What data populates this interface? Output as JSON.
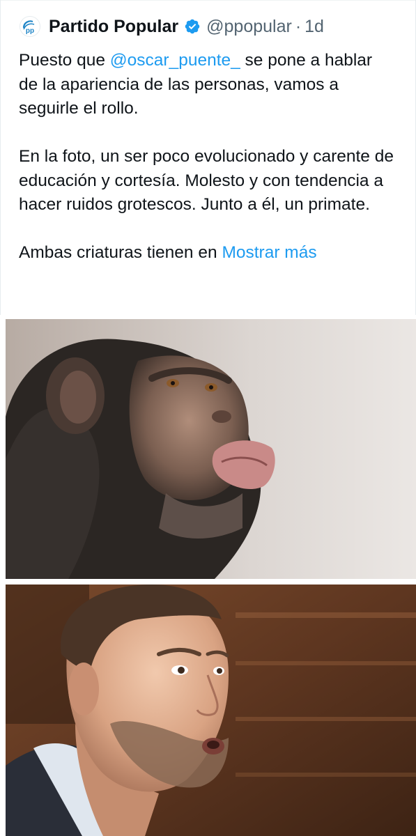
{
  "author": {
    "name": "Partido Popular",
    "handle": "@ppopular",
    "separator": "·",
    "time": "1d",
    "verified": true,
    "avatar_text": "pp",
    "avatar_color": "#1d84c6"
  },
  "tweet": {
    "line1_pre": "Puesto que ",
    "mention": "@oscar_puente_",
    "line1_post": " se pone a hablar de la apariencia de las personas, vamos a seguirle el rollo.",
    "paragraph2": "En la foto, un ser poco evolucionado y carente de educación y cortesía. Molesto y con tendencia a hacer ruidos grotescos. Junto a él, un primate.",
    "paragraph3": "Ambas criaturas tienen en ",
    "show_more": "Mostrar más"
  },
  "colors": {
    "link": "#1d9bf0",
    "text": "#0f1419",
    "secondary": "#536471",
    "verified_badge": "#1d9bf0"
  }
}
